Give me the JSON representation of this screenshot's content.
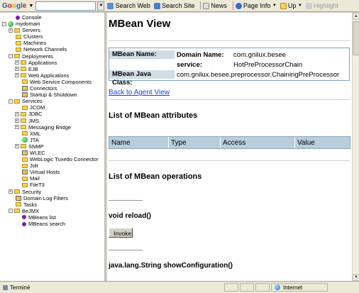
{
  "toolbar": {
    "brand": [
      "G",
      "o",
      "o",
      "g",
      "l",
      "e"
    ],
    "search_web": "Search Web",
    "search_site": "Search Site",
    "news": "News",
    "page_info": "Page Info",
    "up": "Up",
    "highlight": "Highlight"
  },
  "tree": [
    {
      "label": "Console",
      "depth": 1,
      "icon": "dot-purple"
    },
    {
      "label": "mydomain",
      "depth": 0,
      "icon": "globe",
      "exp": "-"
    },
    {
      "label": "Servers",
      "depth": 1,
      "icon": "folder",
      "exp": "+"
    },
    {
      "label": "Clusters",
      "depth": 1,
      "icon": "folder"
    },
    {
      "label": "Machines",
      "depth": 1,
      "icon": "folder"
    },
    {
      "label": "Network Channels",
      "depth": 1,
      "icon": "folder"
    },
    {
      "label": "Deployments",
      "depth": 1,
      "icon": "folder",
      "exp": "-"
    },
    {
      "label": "Applications",
      "depth": 2,
      "icon": "folder",
      "exp": "+"
    },
    {
      "label": "EJB",
      "depth": 2,
      "icon": "folder",
      "exp": "+"
    },
    {
      "label": "Web Applications",
      "depth": 2,
      "icon": "folder",
      "exp": "+"
    },
    {
      "label": "Web Service Components",
      "depth": 2,
      "icon": "folder"
    },
    {
      "label": "Connectors",
      "depth": 2,
      "icon": "misc"
    },
    {
      "label": "Startup & Shutdown",
      "depth": 2,
      "icon": "misc"
    },
    {
      "label": "Services",
      "depth": 1,
      "icon": "folder",
      "exp": "-"
    },
    {
      "label": "JCOM",
      "depth": 2,
      "icon": "folder"
    },
    {
      "label": "JDBC",
      "depth": 2,
      "icon": "folder",
      "exp": "+"
    },
    {
      "label": "JMS",
      "depth": 2,
      "icon": "folder",
      "exp": "+"
    },
    {
      "label": "Messaging Bridge",
      "depth": 2,
      "icon": "folder",
      "exp": "+"
    },
    {
      "label": "XML",
      "depth": 2,
      "icon": "folder"
    },
    {
      "label": "JTA",
      "depth": 2,
      "icon": "globe"
    },
    {
      "label": "SNMP",
      "depth": 2,
      "icon": "folder",
      "exp": "+"
    },
    {
      "label": "WLEC",
      "depth": 2,
      "icon": "misc"
    },
    {
      "label": "WebLogic Tuxedo Connector",
      "depth": 2,
      "icon": "folder"
    },
    {
      "label": "Jolt",
      "depth": 2,
      "icon": "folder"
    },
    {
      "label": "Virtual Hosts",
      "depth": 2,
      "icon": "misc"
    },
    {
      "label": "Mail",
      "depth": 2,
      "icon": "folder"
    },
    {
      "label": "FileT3",
      "depth": 2,
      "icon": "folder"
    },
    {
      "label": "Security",
      "depth": 1,
      "icon": "folder",
      "exp": "+"
    },
    {
      "label": "Domain Log Filters",
      "depth": 1,
      "icon": "misc"
    },
    {
      "label": "Tasks",
      "depth": 1,
      "icon": "folder"
    },
    {
      "label": "BeJMX",
      "depth": 1,
      "icon": "folder",
      "exp": "-"
    },
    {
      "label": "MBeans list",
      "depth": 2,
      "icon": "dot-purple"
    },
    {
      "label": "MBeans search",
      "depth": 2,
      "icon": "dot-purple"
    }
  ],
  "main": {
    "title": "MBean View",
    "mbean_name_label": "MBean Name:",
    "domain_name_label": "Domain Name:",
    "domain_name_value": "com.gnilux.besee",
    "service_label": "service:",
    "service_value": "HotPreProcessorChain",
    "java_class_label": "MBean Java Class:",
    "java_class_value": "com.gnilux.besee.preprocessor.ChainingPreProcessor",
    "back_link": "Back to Agent View",
    "attributes_title": "List of MBean attributes",
    "attr_headers": [
      "Name",
      "Type",
      "Access",
      "Value"
    ],
    "operations_title": "List of MBean operations",
    "op1_signature": "void reload()",
    "invoke_label": "Invoke",
    "op2_signature": "java.lang.String showConfiguration()"
  },
  "status": {
    "message": "Terminé",
    "zone": "Internet"
  }
}
